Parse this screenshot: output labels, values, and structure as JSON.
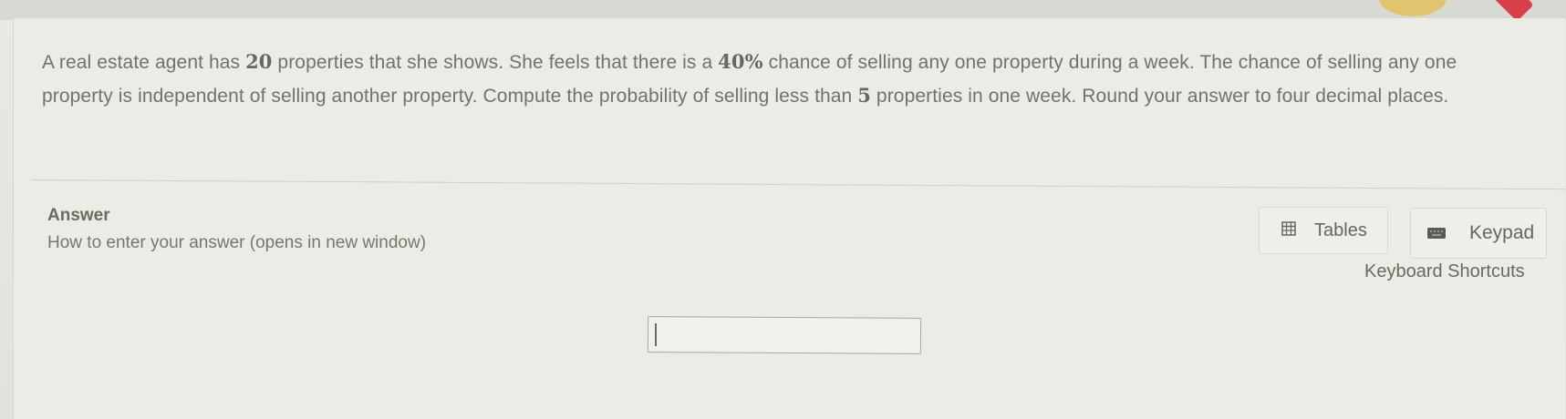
{
  "question": {
    "part1": "A real estate agent has ",
    "num_properties": "20",
    "part2": " properties that she shows. She feels that there is a ",
    "percent": "40%",
    "part3": " chance of selling any one property during a week. The chance of selling any one property is independent of selling another property. Compute the probability of selling less than ",
    "threshold": "5",
    "part4": " properties in one week. Round your answer to four decimal places."
  },
  "answer": {
    "heading": "Answer",
    "how_to_link": "How to enter your answer (opens in new window)",
    "input_value": "",
    "input_placeholder": ""
  },
  "toolbar": {
    "tables_label": "Tables",
    "tables_icon": "table-icon",
    "keypad_label": "Keypad",
    "keypad_icon": "keypad-icon",
    "keyboard_shortcuts_label": "Keyboard Shortcuts"
  },
  "colors": {
    "badge_yellow": "#e4bd54",
    "badge_red": "#d74049"
  }
}
